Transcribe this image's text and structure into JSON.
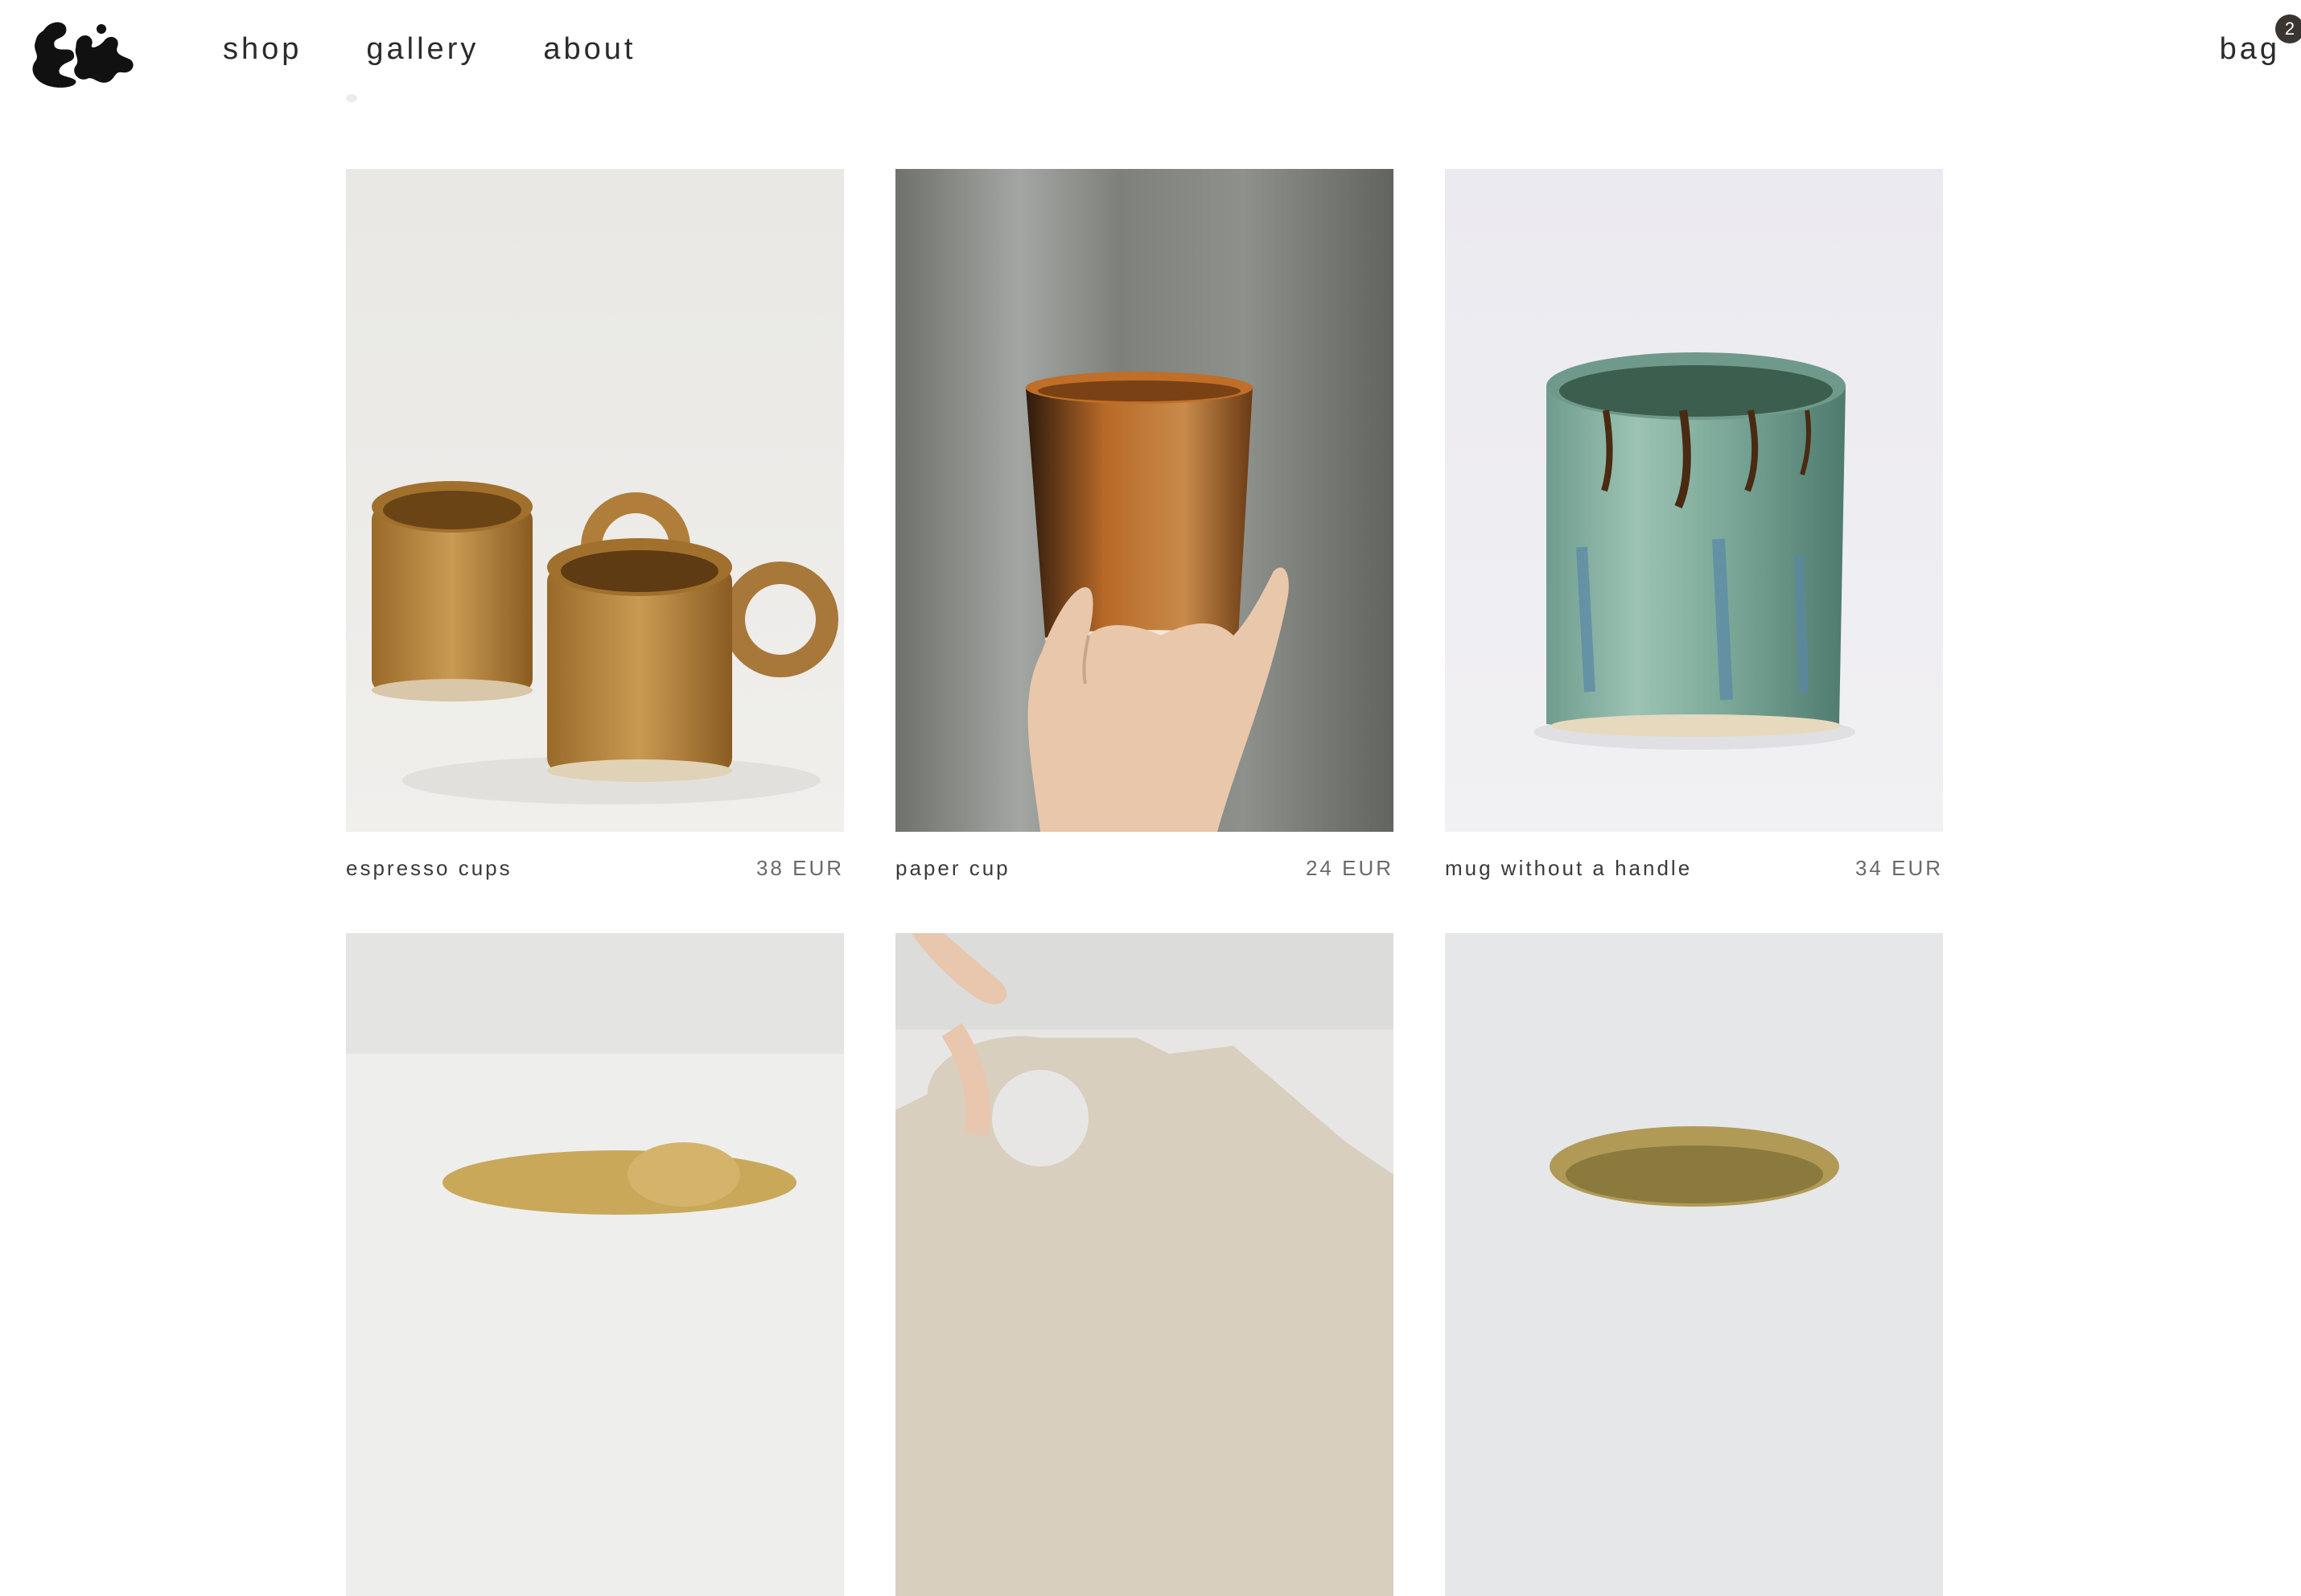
{
  "header": {
    "logo_icon": "ceramic-blob-logo",
    "nav": [
      {
        "label": "shop"
      },
      {
        "label": "gallery"
      },
      {
        "label": "about"
      }
    ],
    "bag": {
      "label": "bag",
      "count": "2"
    }
  },
  "products": [
    {
      "name": "espresso cups",
      "price": "38 EUR",
      "image": "two-honey-glazed-espresso-cups"
    },
    {
      "name": "paper cup",
      "price": "24 EUR",
      "image": "hand-holding-rust-glazed-cup"
    },
    {
      "name": "mug without a handle",
      "price": "34 EUR",
      "image": "green-drip-glazed-cylinder-mug"
    },
    {
      "name": "",
      "price": "",
      "image": "yellow-glazed-mug-partial"
    },
    {
      "name": "",
      "price": "",
      "image": "speckled-beige-mug-held-by-handle"
    },
    {
      "name": "",
      "price": "",
      "image": "olive-glazed-bowl-partial"
    }
  ],
  "colors": {
    "text": "#2b2b2b",
    "price": "#6a6a6a",
    "badge": "#3a3530",
    "background": "#ffffff"
  }
}
